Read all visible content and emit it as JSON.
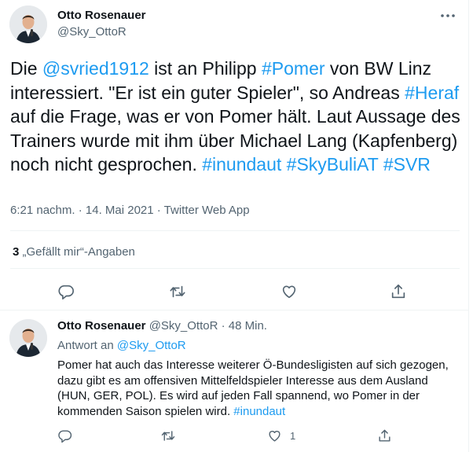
{
  "main_tweet": {
    "author_name": "Otto Rosenauer",
    "author_handle": "@Sky_OttoR",
    "text_segments": [
      {
        "text": "Die ",
        "link": false
      },
      {
        "text": "@svried1912",
        "link": true
      },
      {
        "text": " ist an Philipp ",
        "link": false
      },
      {
        "text": "#Pomer",
        "link": true
      },
      {
        "text": " von BW Linz interessiert. \"Er ist ein guter Spieler\", so Andreas ",
        "link": false
      },
      {
        "text": "#Heraf",
        "link": true
      },
      {
        "text": " auf die Frage, was er von Pomer hält. Laut Aussage des Trainers wurde mit ihm über Michael Lang (Kapfenberg) noch nicht gesprochen. ",
        "link": false
      },
      {
        "text": "#inundaut",
        "link": true
      },
      {
        "text": " ",
        "link": false
      },
      {
        "text": "#SkyBuliAT",
        "link": true
      },
      {
        "text": " ",
        "link": false
      },
      {
        "text": "#SVR",
        "link": true
      }
    ],
    "timestamp": "6:21 nachm. · 14. Mai 2021 · Twitter Web App",
    "likes_count": "3",
    "likes_label": "„Gefällt mir“-Angaben"
  },
  "reply_tweet": {
    "author_name": "Otto Rosenauer",
    "author_handle": "@Sky_OttoR",
    "time_ago": "· 48 Min.",
    "replying_prefix": "Antwort an",
    "replying_to": "@Sky_OttoR",
    "text": "Pomer hat auch das Interesse weiterer Ö-Bundesligisten auf sich gezogen, dazu gibt es am offensiven Mittelfeldspieler Interesse aus dem Ausland (HUN, GER, POL). Es wird auf jeden Fall spannend, wo Pomer in der kommenden Saison spielen wird.",
    "hashtag": "#inundaut",
    "like_count": "1"
  },
  "icons": {
    "more": "more-horizontal-icon",
    "reply": "reply-icon",
    "retweet": "retweet-icon",
    "like": "heart-icon",
    "share": "share-icon"
  },
  "colors": {
    "link": "#1d9bf0",
    "secondary_text": "#536471",
    "primary_text": "#0f1419",
    "divider": "#eff3f4"
  }
}
